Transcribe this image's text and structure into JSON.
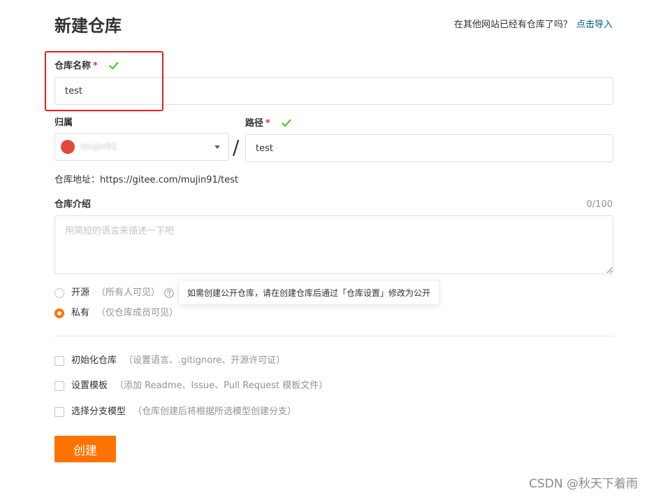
{
  "header": {
    "title": "新建仓库",
    "import_hint": "在其他网站已经有仓库了吗？",
    "import_link": "点击导入"
  },
  "repo_name": {
    "label": "仓库名称",
    "required_mark": "*",
    "value": "test"
  },
  "owner": {
    "label": "归属",
    "selected": "mujin91"
  },
  "path": {
    "label": "路径",
    "required_mark": "*",
    "separator": "/",
    "value": "test"
  },
  "repo_address": {
    "text": "仓库地址：https://gitee.com/mujin91/test"
  },
  "description": {
    "label": "仓库介绍",
    "counter": "0/100",
    "placeholder": "用简短的语言来描述一下吧"
  },
  "visibility": {
    "public_label": "开源",
    "public_hint": "（所有人可见）",
    "private_label": "私有",
    "private_hint": "（仅仓库成员可见）",
    "selected": "private",
    "tooltip": "如需创建公开仓库，请在创建仓库后通过「仓库设置」修改为公开"
  },
  "options": [
    {
      "label": "初始化仓库",
      "hint": "（设置语言、.gitignore、开源许可证）",
      "checked": false
    },
    {
      "label": "设置模板",
      "hint": "（添加 Readme、Issue、Pull Request 模板文件）",
      "checked": false
    },
    {
      "label": "选择分支模型",
      "hint": "（仓库创建后将根据所选模型创建分支）",
      "checked": false
    }
  ],
  "submit": {
    "label": "创建"
  },
  "watermark": "CSDN @秋天下着雨",
  "colors": {
    "accent": "#fe7300",
    "link": "#005980",
    "success": "#52c41a",
    "required": "#e03131",
    "annotation_box": "#e02020"
  }
}
